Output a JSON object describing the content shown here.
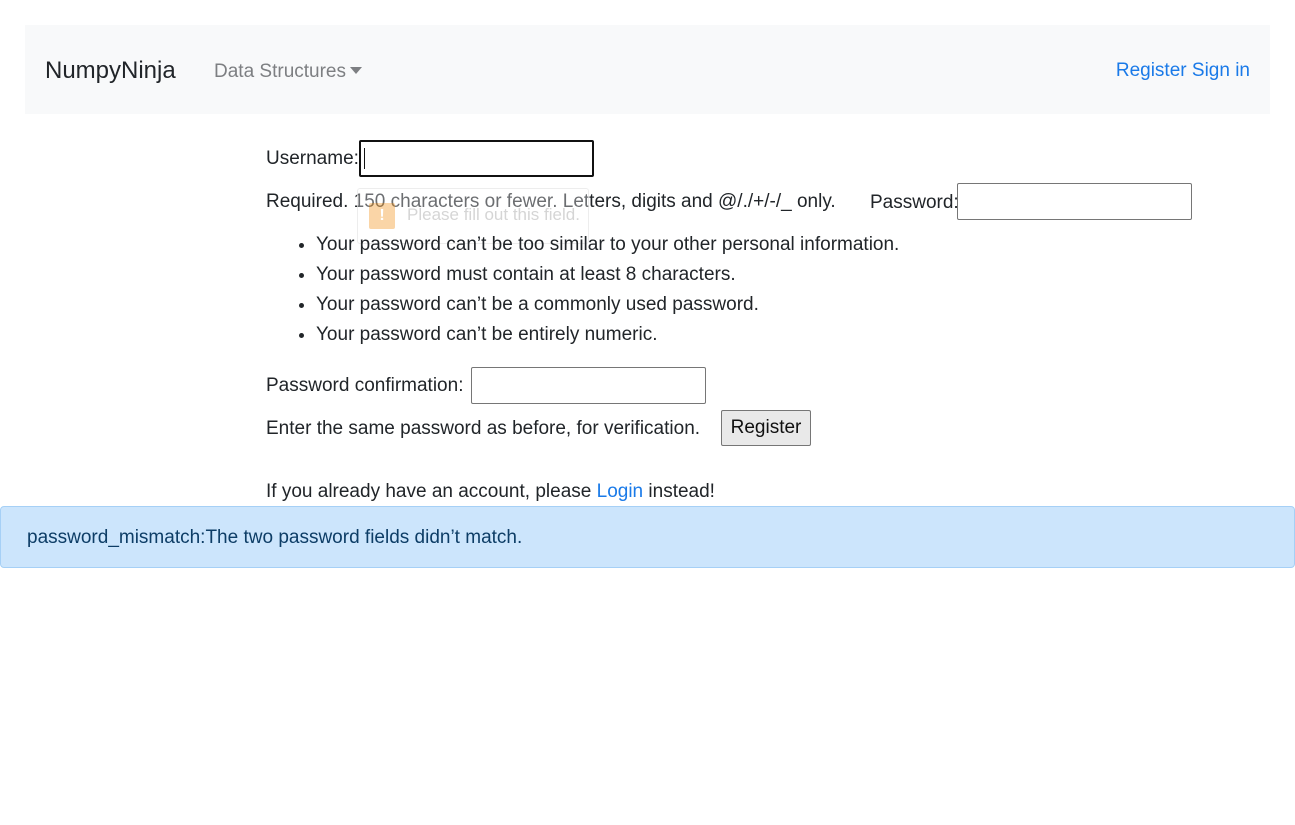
{
  "navbar": {
    "brand": "NumpyNinja",
    "dropdown_label": "Data Structures",
    "register_link": "Register",
    "signin_link": "Sign in"
  },
  "form": {
    "username_label": "Username:",
    "username_value": "",
    "username_help": "Required. 150 characters or fewer. Letters, digits and @/./+/-/_ only.",
    "password_label": "Password:",
    "password_value": "",
    "password_rules": [
      "Your password can’t be too similar to your other personal information.",
      "Your password must contain at least 8 characters.",
      "Your password can’t be a commonly used password.",
      "Your password can’t be entirely numeric."
    ],
    "confirm_label": "Password confirmation:",
    "confirm_value": "",
    "confirm_help": "Enter the same password as before, for verification.",
    "submit_label": "Register",
    "login_prompt_before": "If you already have an account, please",
    "login_link": "Login",
    "login_prompt_after": "instead!"
  },
  "tooltip": {
    "icon": "warning-icon",
    "text": "Please fill out this field."
  },
  "alert": {
    "message": "password_mismatch:The two password fields didn’t match."
  },
  "colors": {
    "link": "#1a7ae8",
    "navbar_bg": "#f8f9fa",
    "alert_bg": "#cce5fc",
    "alert_text": "#0d3d66"
  }
}
